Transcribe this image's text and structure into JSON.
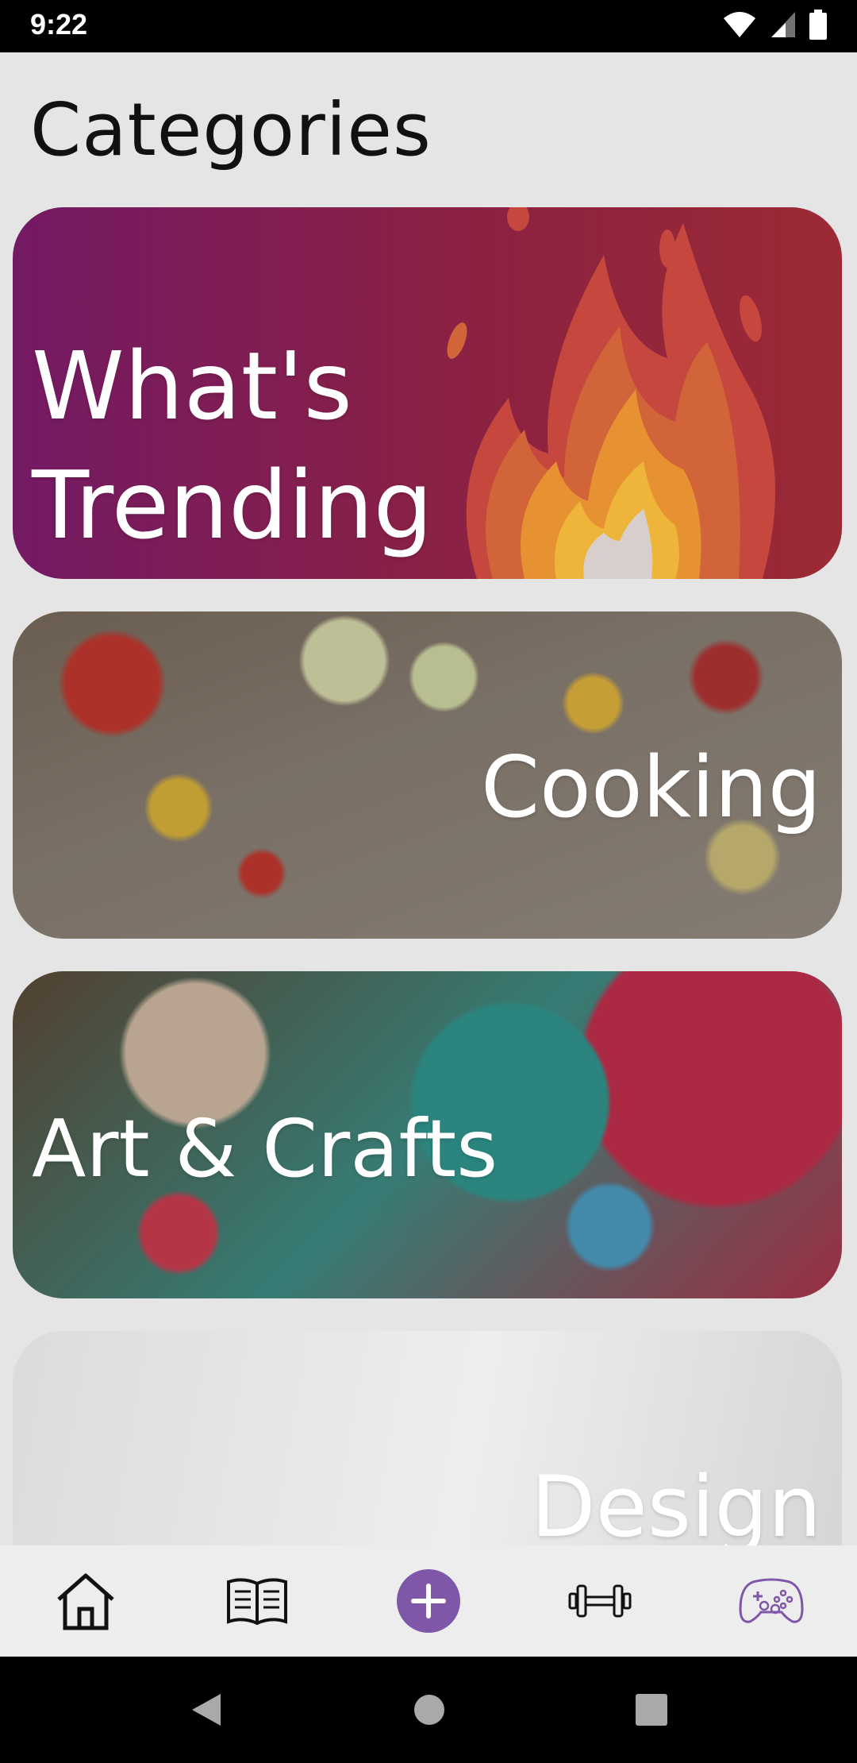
{
  "status_bar": {
    "time": "9:22",
    "icons": [
      "wifi-icon",
      "signal-icon",
      "battery-icon"
    ]
  },
  "page": {
    "title": "Categories"
  },
  "categories": [
    {
      "label": "What's Trending",
      "image": "fire-illustration"
    },
    {
      "label": "Cooking",
      "image": "cooking-photo"
    },
    {
      "label": "Art & Crafts",
      "image": "crafts-photo"
    },
    {
      "label": "Design",
      "image": "design-sketch-photo"
    }
  ],
  "bottom_nav": {
    "items": [
      {
        "icon": "home-icon"
      },
      {
        "icon": "book-icon"
      },
      {
        "icon": "add-icon",
        "accent": "#7e57a8"
      },
      {
        "icon": "dumbbell-icon"
      },
      {
        "icon": "gamepad-icon",
        "color": "#7e57a8"
      }
    ]
  },
  "system_nav": {
    "icons": [
      "back-icon",
      "home-circle-icon",
      "recents-icon"
    ]
  }
}
